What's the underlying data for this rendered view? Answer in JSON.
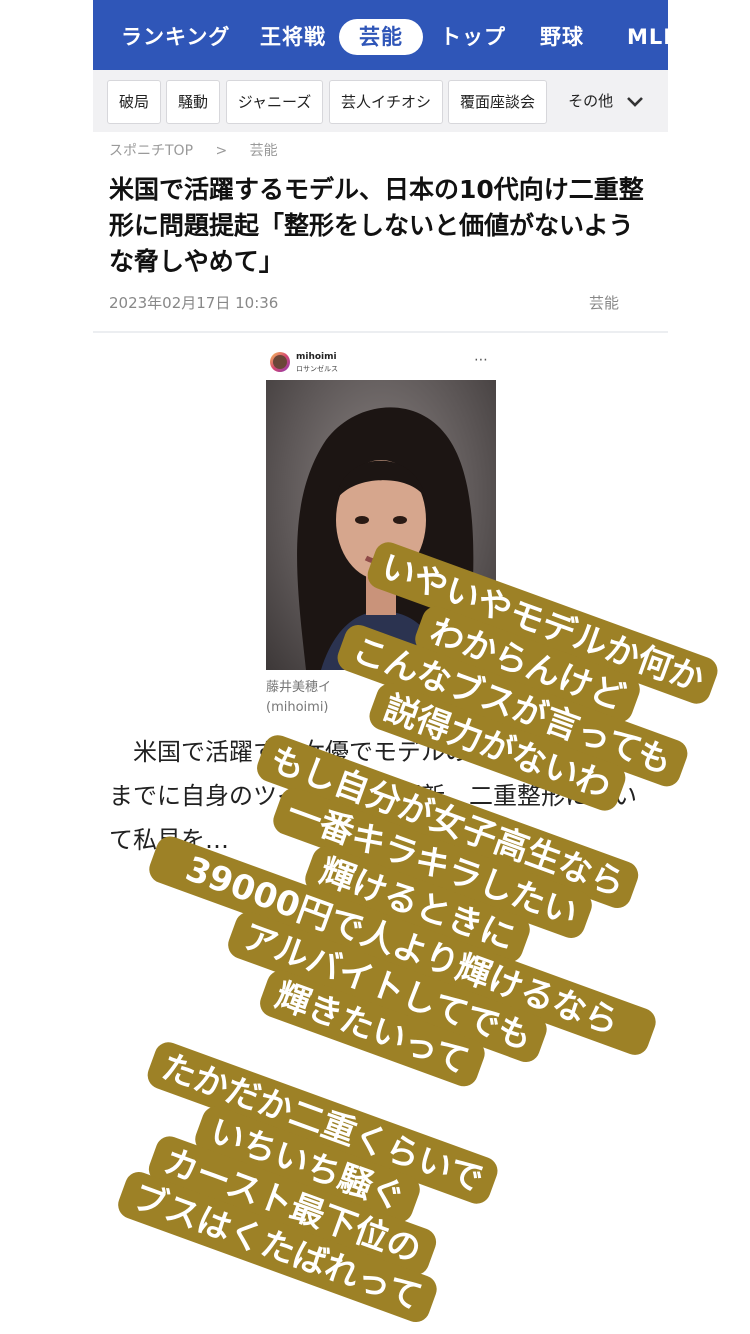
{
  "nav": {
    "tabs": [
      "ランキング",
      "王将戦",
      "芸能",
      "トップ",
      "野球",
      "MLB"
    ],
    "active": "芸能"
  },
  "subnav": {
    "chips": [
      "破局",
      "騒動",
      "ジャニーズ",
      "芸人イチオシ",
      "覆面座談会"
    ],
    "more_label": "その他"
  },
  "breadcrumb": {
    "home": "スポニチTOP",
    "separator": ">",
    "section": "芸能"
  },
  "article": {
    "headline": "米国で活躍するモデル、日本の10代向け二重整形に問題提起「整形をしないと価値がないような脅しやめて」",
    "date": "2023年02月17日  10:36",
    "category": "芸能",
    "instagram": {
      "username": "mihoimi",
      "location": "ロサンゼルス"
    },
    "caption_line1": "藤井美穂イ",
    "caption_line2": "(mihoimi)",
    "body_fragment": "米国で活躍する女優でモデルの藤井美穂が…日までに自身のツイッターを更新。二重整形について私見を…"
  },
  "overlay": {
    "blocks": [
      {
        "lines": [
          "いやいやモデルか何か",
          "わからんけど",
          "こんなブスが言っても",
          "説得力がないわ"
        ]
      },
      {
        "lines": [
          "もし自分が女子高生なら",
          "一番キラキラしたい",
          "輝けるときに",
          "39000円で人より輝けるなら",
          "アルバイトしてでも",
          "輝きたいって"
        ]
      },
      {
        "lines": [
          "たかだか二重くらいで",
          "いちいち騒ぐ",
          "カースト最下位の",
          "ブスはくたばれって"
        ]
      }
    ],
    "bubble_color": "#9d8126",
    "text_color": "#ffffff"
  },
  "colors": {
    "nav_blue": "#2f56b8"
  }
}
